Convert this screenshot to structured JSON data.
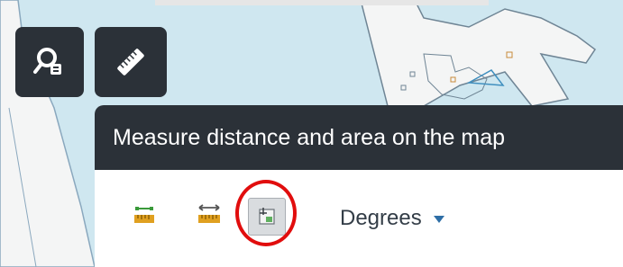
{
  "toolbar": {
    "query_button": {
      "icon": "zoom-to-location-icon"
    },
    "measure_button": {
      "icon": "ruler-icon"
    }
  },
  "tooltip": {
    "text": "Measure distance and area on the map"
  },
  "measure_panel": {
    "tools": [
      {
        "name": "distance",
        "icon": "measure-distance-icon"
      },
      {
        "name": "area",
        "icon": "measure-area-icon"
      },
      {
        "name": "location",
        "icon": "measure-location-icon",
        "selected": true
      }
    ],
    "unit_select": {
      "value": "Degrees",
      "icon": "caret-down-icon"
    }
  },
  "colors": {
    "button_bg": "#2b3138",
    "highlight_ring": "#e10d0d",
    "map_land": "#ffffff",
    "map_water": "#cfe7f0",
    "tool_accent_green": "#3a9a3a",
    "caret_blue": "#2e6ea6"
  }
}
